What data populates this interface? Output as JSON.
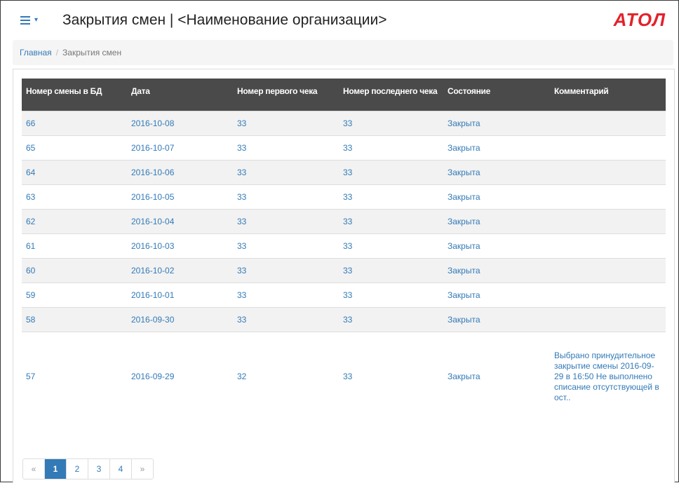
{
  "header": {
    "title": "Закрытия смен | <Наименование организации>",
    "logo": "ATOЛ",
    "menu_icon": "hamburger-icon"
  },
  "breadcrumb": {
    "home": "Главная",
    "separator": "/",
    "current": "Закрытия смен"
  },
  "table": {
    "columns": [
      "Номер смены в БД",
      "Дата",
      "Номер первого чека",
      "Номер последнего чека",
      "Состояние",
      "Комментарий"
    ],
    "rows": [
      {
        "id": "66",
        "date": "2016-10-08",
        "first": "33",
        "last": "33",
        "state": "Закрыта",
        "comment": ""
      },
      {
        "id": "65",
        "date": "2016-10-07",
        "first": "33",
        "last": "33",
        "state": "Закрыта",
        "comment": ""
      },
      {
        "id": "64",
        "date": "2016-10-06",
        "first": "33",
        "last": "33",
        "state": "Закрыта",
        "comment": ""
      },
      {
        "id": "63",
        "date": "2016-10-05",
        "first": "33",
        "last": "33",
        "state": "Закрыта",
        "comment": ""
      },
      {
        "id": "62",
        "date": "2016-10-04",
        "first": "33",
        "last": "33",
        "state": "Закрыта",
        "comment": ""
      },
      {
        "id": "61",
        "date": "2016-10-03",
        "first": "33",
        "last": "33",
        "state": "Закрыта",
        "comment": ""
      },
      {
        "id": "60",
        "date": "2016-10-02",
        "first": "33",
        "last": "33",
        "state": "Закрыта",
        "comment": ""
      },
      {
        "id": "59",
        "date": "2016-10-01",
        "first": "33",
        "last": "33",
        "state": "Закрыта",
        "comment": ""
      },
      {
        "id": "58",
        "date": "2016-09-30",
        "first": "33",
        "last": "33",
        "state": "Закрыта",
        "comment": ""
      },
      {
        "id": "57",
        "date": "2016-09-29",
        "first": "32",
        "last": "33",
        "state": "Закрыта",
        "comment": "Выбрано принудительное закрытие смены 2016-09-29 в 16:50 Не выполнено списание отсутствующей в ост.."
      }
    ]
  },
  "pagination": {
    "prev": "«",
    "pages": [
      "1",
      "2",
      "3",
      "4"
    ],
    "active": "1",
    "next": "»"
  },
  "colors": {
    "accent": "#337ab7",
    "header_bg": "#4a4a4a",
    "logo": "#e3222b"
  }
}
